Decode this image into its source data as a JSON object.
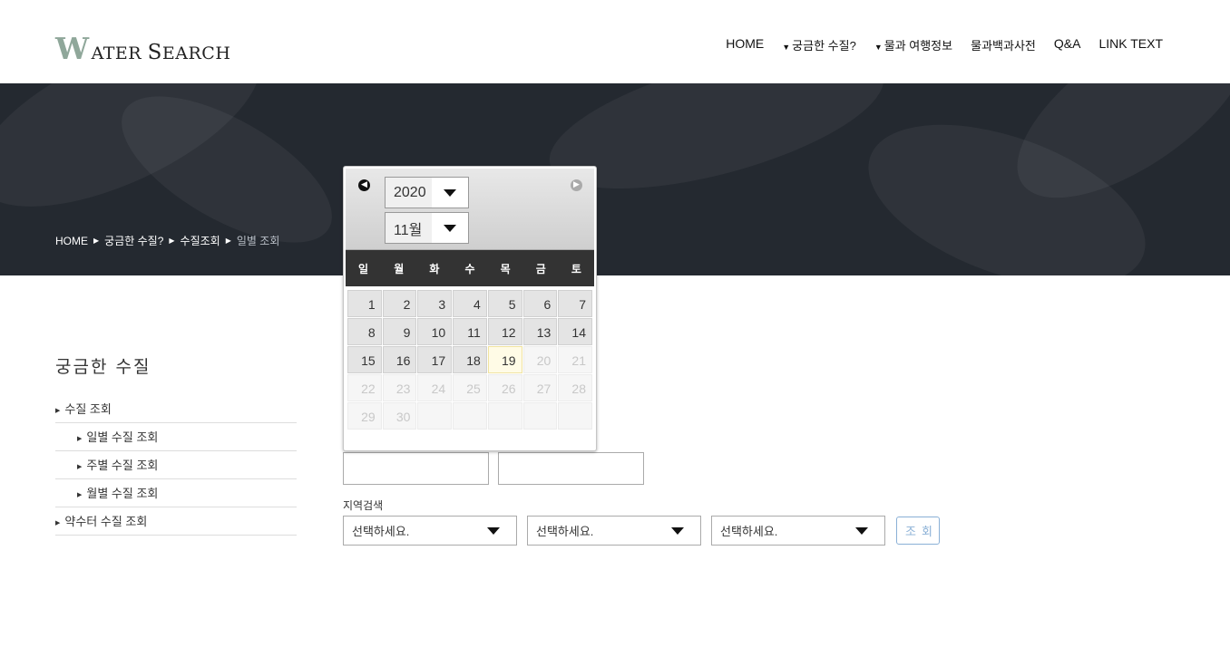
{
  "header": {
    "logo_w": "W",
    "logo_ater": "ATER ",
    "logo_s": "S",
    "logo_earch": "EARCH",
    "nav": {
      "home": "HOME",
      "curious": "궁금한 수질?",
      "travel": "물과 여행정보",
      "encyclopedia": "물과백과사전",
      "qa": "Q&A",
      "link": "LINK TEXT"
    }
  },
  "banner": {
    "breadcrumb": {
      "home": "HOME",
      "curious": "궁금한 수질?",
      "lookup": "수질조회",
      "current": "일별 조회"
    }
  },
  "sidebar": {
    "title": "궁금한 수질",
    "items": [
      {
        "label": "수질 조회"
      },
      {
        "label": "일별 수질 조회"
      },
      {
        "label": "주별 수질 조회"
      },
      {
        "label": "월별 수질 조회"
      },
      {
        "label": "약수터 수질 조회"
      }
    ]
  },
  "datepicker": {
    "year": "2020",
    "month": "11월",
    "weekdays": [
      "일",
      "월",
      "화",
      "수",
      "목",
      "금",
      "토"
    ],
    "days": [
      "1",
      "2",
      "3",
      "4",
      "5",
      "6",
      "7",
      "8",
      "9",
      "10",
      "11",
      "12",
      "13",
      "14",
      "15",
      "16",
      "17",
      "18",
      "19",
      "20",
      "21",
      "22",
      "23",
      "24",
      "25",
      "26",
      "27",
      "28",
      "29",
      "30"
    ],
    "today": "19"
  },
  "form": {
    "start_date": "",
    "end_date": "",
    "region_label": "지역검색",
    "selects": [
      "선택하세요.",
      "선택하세요.",
      "선택하세요."
    ],
    "search_button": "조회"
  }
}
